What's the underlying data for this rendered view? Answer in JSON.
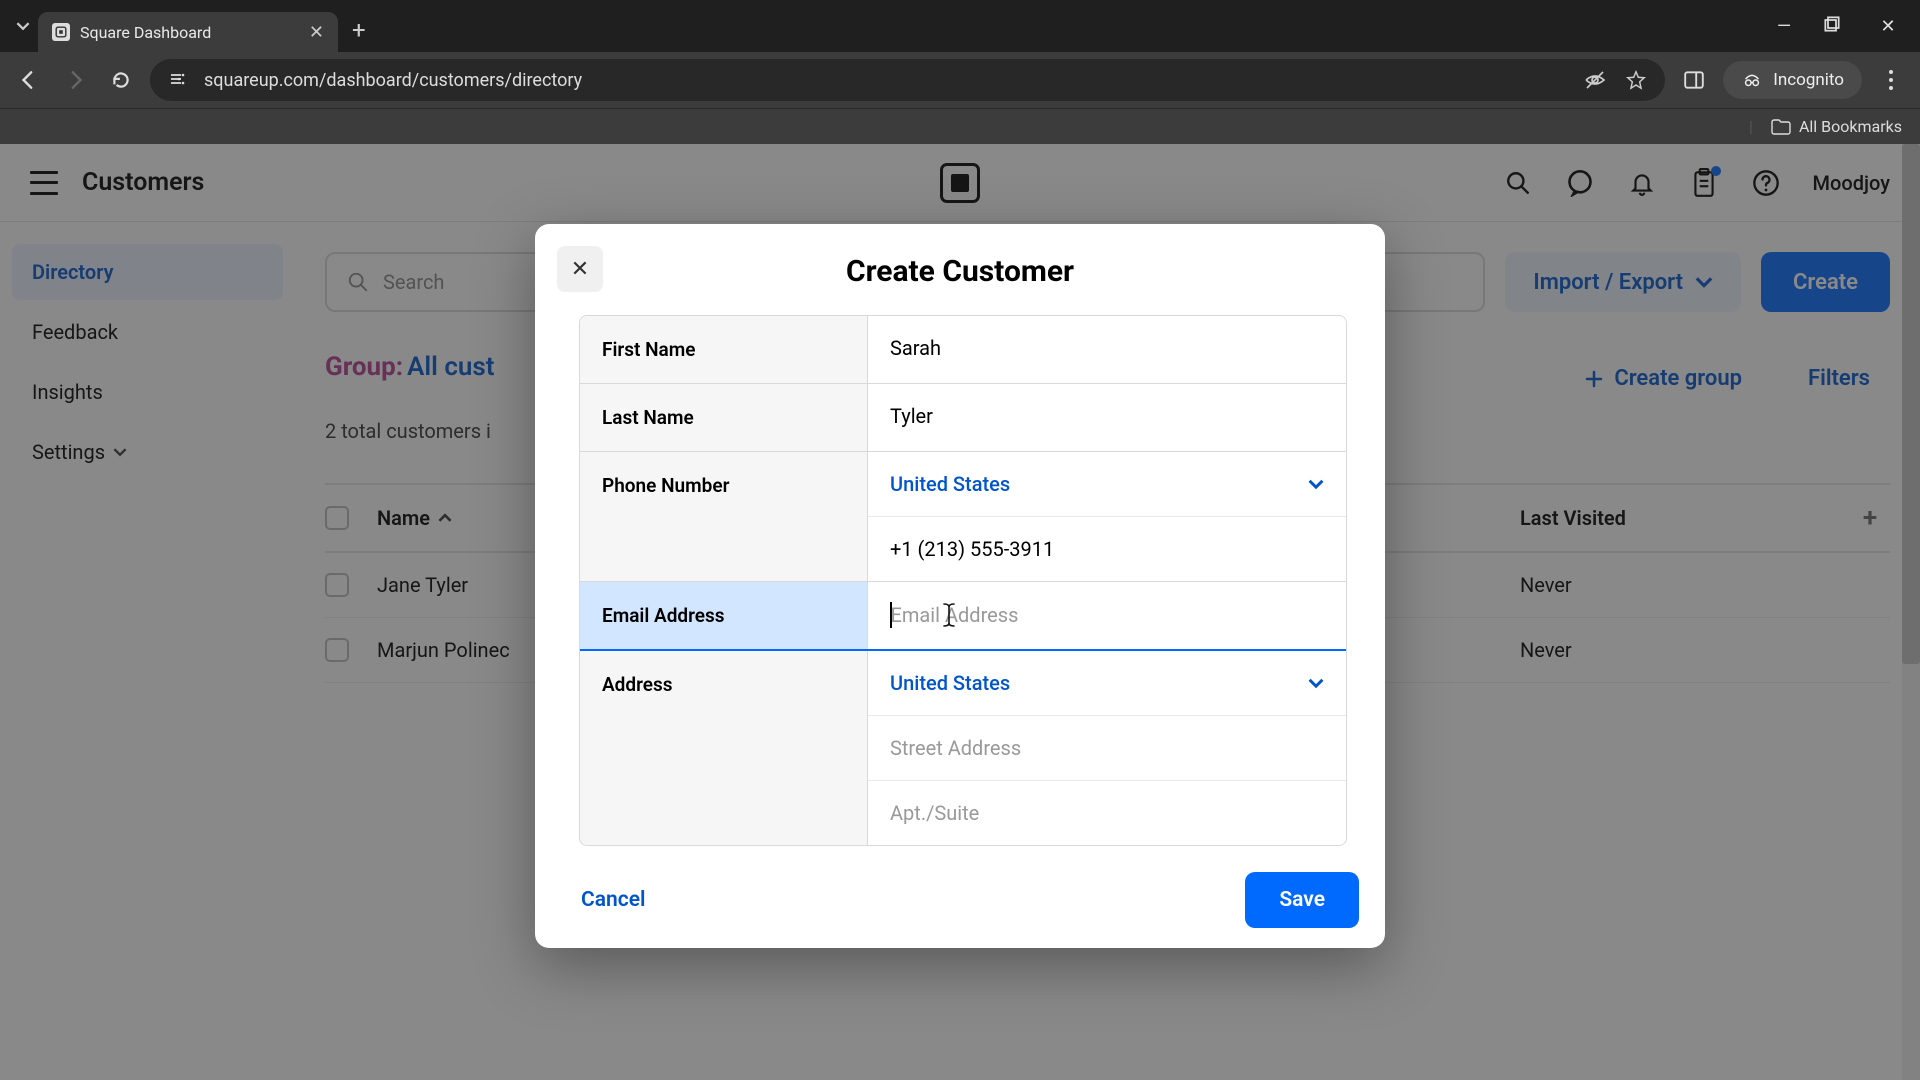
{
  "browser": {
    "tab_title": "Square Dashboard",
    "url": "squareup.com/dashboard/customers/directory",
    "incognito_label": "Incognito",
    "all_bookmarks": "All Bookmarks"
  },
  "header": {
    "page": "Customers",
    "username": "Moodjoy"
  },
  "sidebar": {
    "items": [
      {
        "label": "Directory",
        "active": true
      },
      {
        "label": "Feedback",
        "active": false
      },
      {
        "label": "Insights",
        "active": false
      },
      {
        "label": "Settings",
        "active": false,
        "has_caret": true
      }
    ]
  },
  "toolbar": {
    "search_placeholder": "Search",
    "import_export": "Import / Export",
    "create": "Create"
  },
  "group": {
    "label": "Group:",
    "value": "All cust",
    "create_group": "Create group",
    "filters": "Filters",
    "subtext": "2 total customers i"
  },
  "table": {
    "col_name": "Name",
    "col_last": "Last Visited",
    "rows": [
      {
        "name": "Jane Tyler",
        "last": "Never"
      },
      {
        "name": "Marjun Polinec",
        "last": "Never"
      }
    ]
  },
  "modal": {
    "title": "Create Customer",
    "fields": {
      "first_name": {
        "label": "First Name",
        "value": "Sarah"
      },
      "last_name": {
        "label": "Last Name",
        "value": "Tyler"
      },
      "phone": {
        "label": "Phone Number",
        "country": "United States",
        "value": "+1 (213) 555-3911"
      },
      "email": {
        "label": "Email Address",
        "placeholder": "Email Address"
      },
      "address": {
        "label": "Address",
        "country": "United States",
        "street_placeholder": "Street Address",
        "apt_placeholder": "Apt./Suite"
      }
    },
    "cancel": "Cancel",
    "save": "Save"
  }
}
